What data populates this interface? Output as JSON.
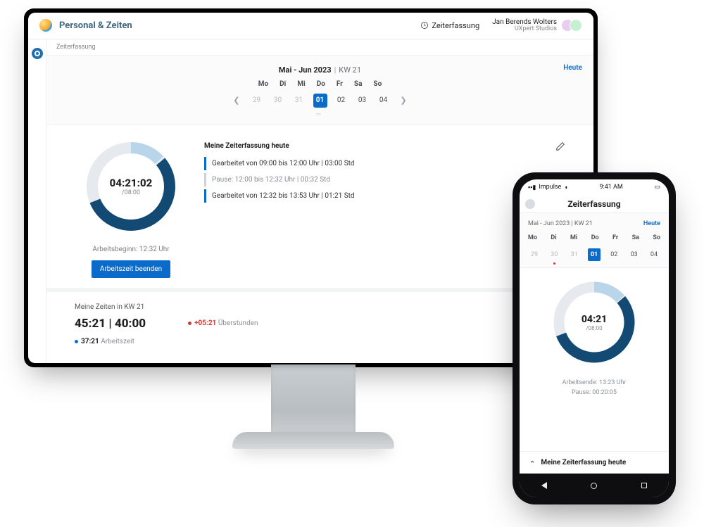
{
  "desktop": {
    "header": {
      "title": "Personal & Zeiten",
      "tab": "Zeiterfassung",
      "user_name": "Jan Berends Wolters",
      "user_sub": "UXpert Studios"
    },
    "crumb": "Zeiterfassung",
    "cal": {
      "range": "Mai - Jun 2023",
      "kw": "KW 21",
      "today": "Heute",
      "dow": [
        "Mo",
        "Di",
        "Mi",
        "Do",
        "Fr",
        "Sa",
        "So"
      ],
      "days": [
        "29",
        "30",
        "31",
        "01",
        "02",
        "03",
        "04"
      ],
      "selected_index": 3
    },
    "clock": {
      "elapsed": "04:21:02",
      "total": "/08:00",
      "start": "Arbeitsbeginn: 12:32 Uhr",
      "button": "Arbeitszeit beenden"
    },
    "today": {
      "title": "Meine Zeiterfassung heute",
      "lines": [
        "Gearbeitet von 09:00 bis 12:00 Uhr | 03:00 Std",
        "Pause: 12:00 bis 12:32 Uhr | 00:32 Std",
        "Gearbeitet von 12:32 bis 13:53 Uhr | 01:21 Std"
      ]
    },
    "lower": {
      "title": "Meine Zeiten in KW 21",
      "worked_planned": "45:21 | 40:00",
      "overtime": "+05:21",
      "overtime_label": "Überstunden",
      "sub_value": "37:21",
      "sub_label": "Arbeitszeit"
    }
  },
  "phone": {
    "status_carrier": "Impulse",
    "status_time": "9:41 AM",
    "title": "Zeiterfassung",
    "cal": {
      "range": "Mai - Jun 2023 | KW 21",
      "today": "Heute",
      "dow": [
        "Mo",
        "Di",
        "Mi",
        "Do",
        "Fr",
        "Sa",
        "So"
      ],
      "days": [
        "29",
        "30",
        "31",
        "01",
        "02",
        "03",
        "04"
      ],
      "selected_index": 3
    },
    "clock": {
      "elapsed": "04:21",
      "total": "/08:00",
      "end": "Arbeitsende: 13:23 Uhr",
      "pause": "Pause: 00:20:05"
    },
    "expand": "Meine Zeiterfassung heute"
  }
}
